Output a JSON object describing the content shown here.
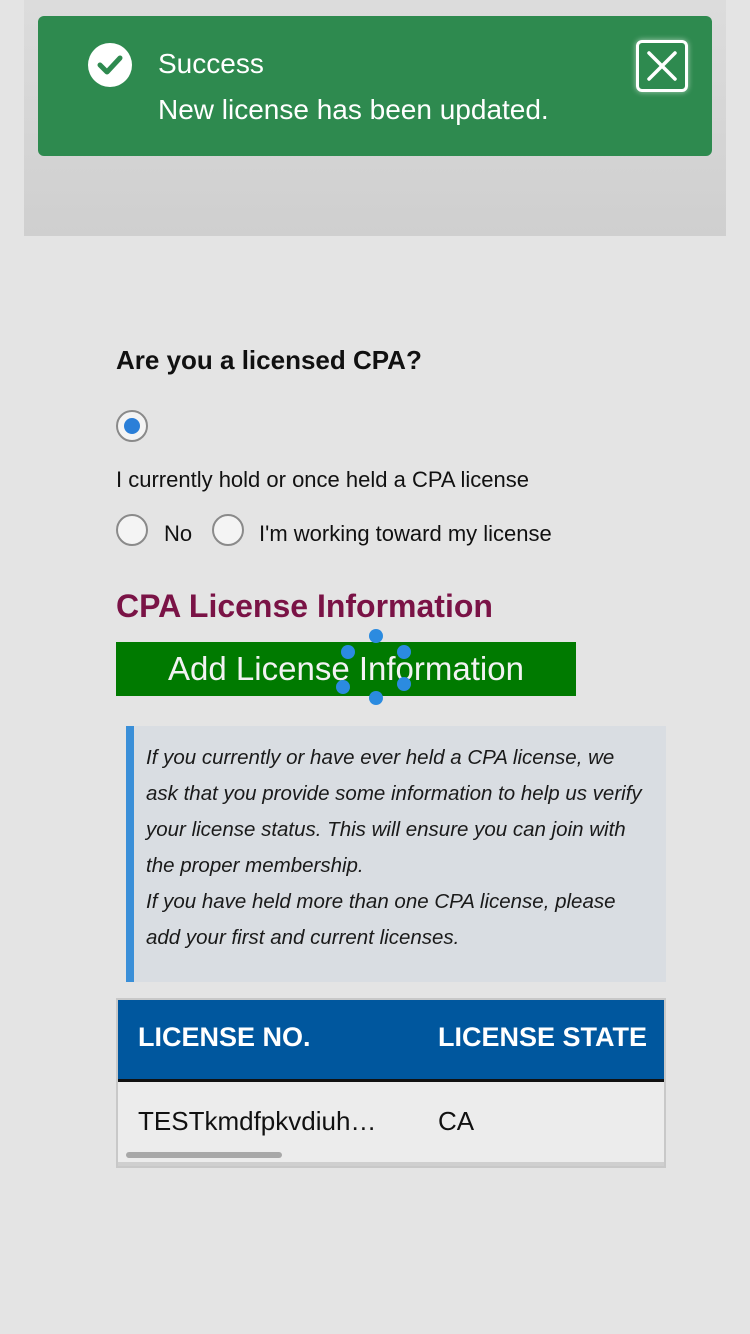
{
  "toast": {
    "title": "Success",
    "message": "New license has been updated.",
    "icons": {
      "status": "check-circle-icon",
      "close": "close-icon"
    }
  },
  "form": {
    "question": "Are you a licensed CPA?",
    "options": [
      {
        "label": "I currently hold or once held a CPA license",
        "selected": true
      },
      {
        "label": "No",
        "selected": false
      },
      {
        "label": "I'm working toward my license",
        "selected": false
      }
    ]
  },
  "license_section": {
    "title": "CPA License Information",
    "add_button_label": "Add License Information",
    "info_paragraph_1": "If you currently or have ever held a CPA license, we ask that you provide some information to help us verify your license status. This will ensure you can join with the proper membership.",
    "info_paragraph_2": "If you have held more than one CPA license, please add your first and current licenses."
  },
  "table": {
    "headers": [
      "LICENSE NO.",
      "LICENSE STATE"
    ],
    "rows": [
      [
        "TESTkmdfpkvdiuh…",
        "CA"
      ]
    ]
  },
  "colors": {
    "toast_bg": "#2e8a4f",
    "section_title": "#7a1346",
    "button_bg": "#007a00",
    "table_header_bg": "#00579e",
    "info_accent": "#3a8fd8",
    "radio_selected": "#2b7fd8"
  }
}
